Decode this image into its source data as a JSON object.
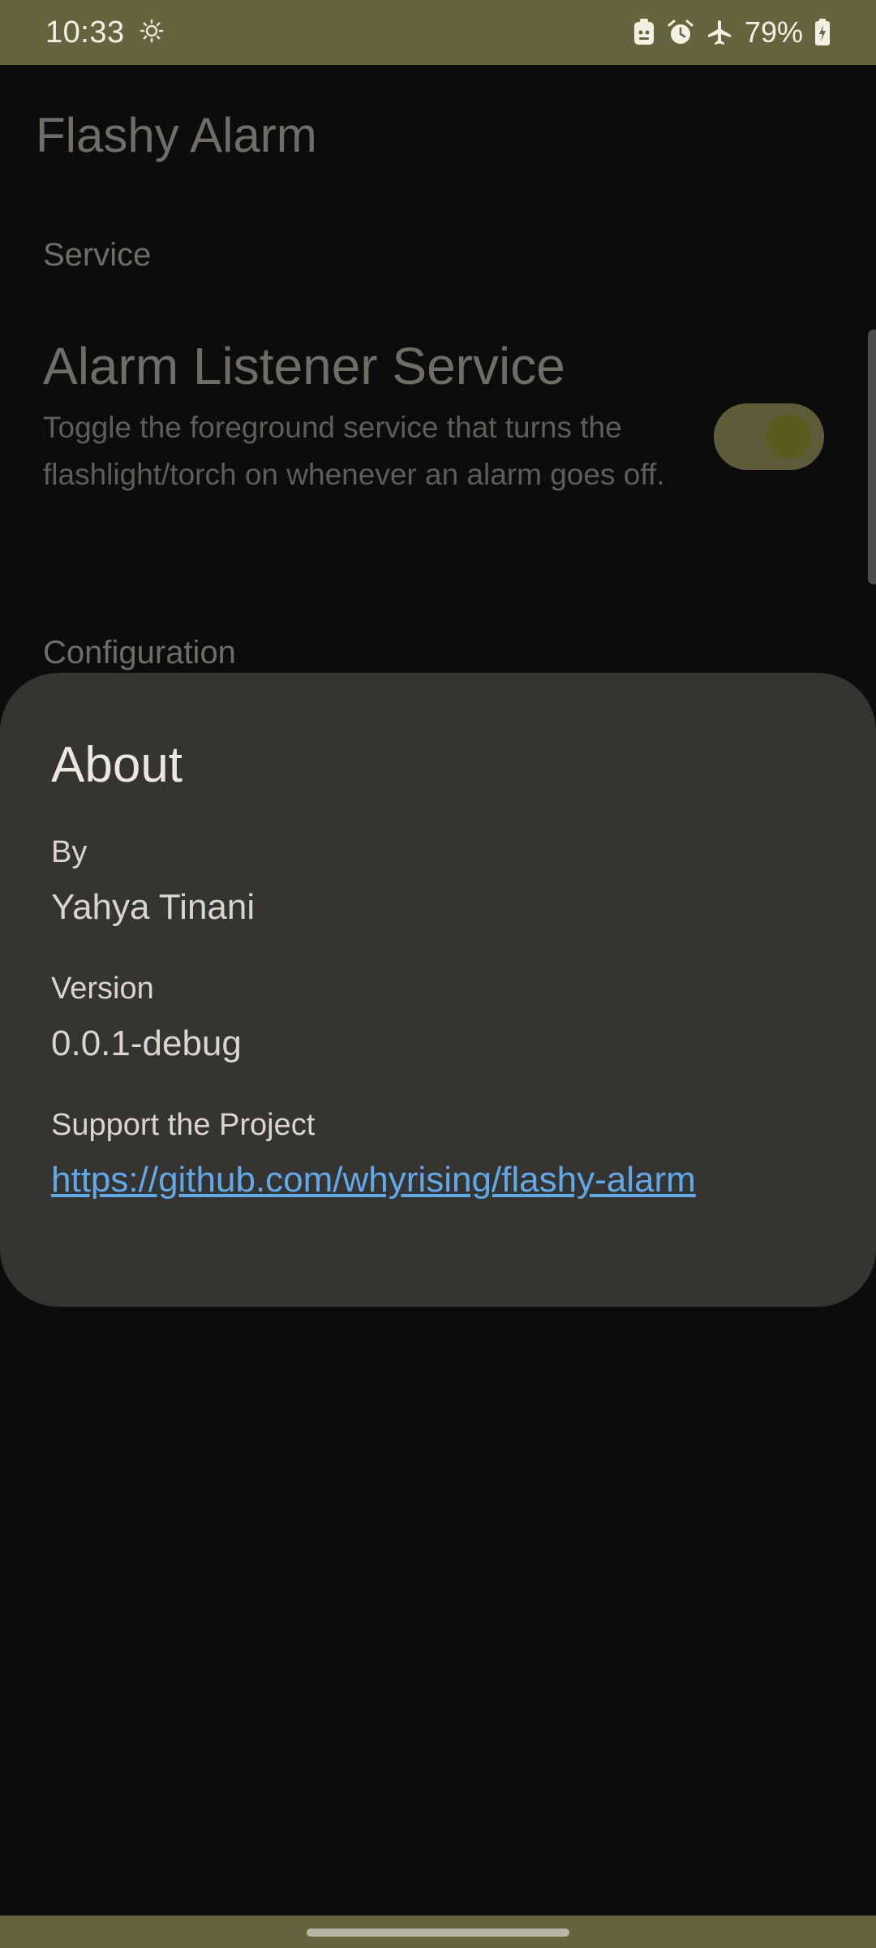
{
  "status_bar": {
    "time": "10:33",
    "battery": "79%",
    "icons": [
      "brightness-icon",
      "robot-icon",
      "alarm-icon",
      "airplane-icon",
      "battery-icon"
    ]
  },
  "app": {
    "title": "Flashy Alarm",
    "sections": {
      "service": "Service",
      "configuration": "Configuration"
    },
    "alarm_listener": {
      "title": "Alarm Listener Service",
      "summary": "Toggle the foreground service that turns the flashlight/torch on whenever an alarm goes off.",
      "enabled": true
    }
  },
  "dialog": {
    "title": "About",
    "by_label": "By",
    "by_value": "Yahya Tinani",
    "version_label": "Version",
    "version_value": "0.0.1-debug",
    "support_label": "Support the Project",
    "support_link": "https://github.com/whyrising/flashy-alarm"
  },
  "colors": {
    "accent": "#66643f",
    "dialog_surface": "#353430",
    "link": "#62a9ea"
  }
}
